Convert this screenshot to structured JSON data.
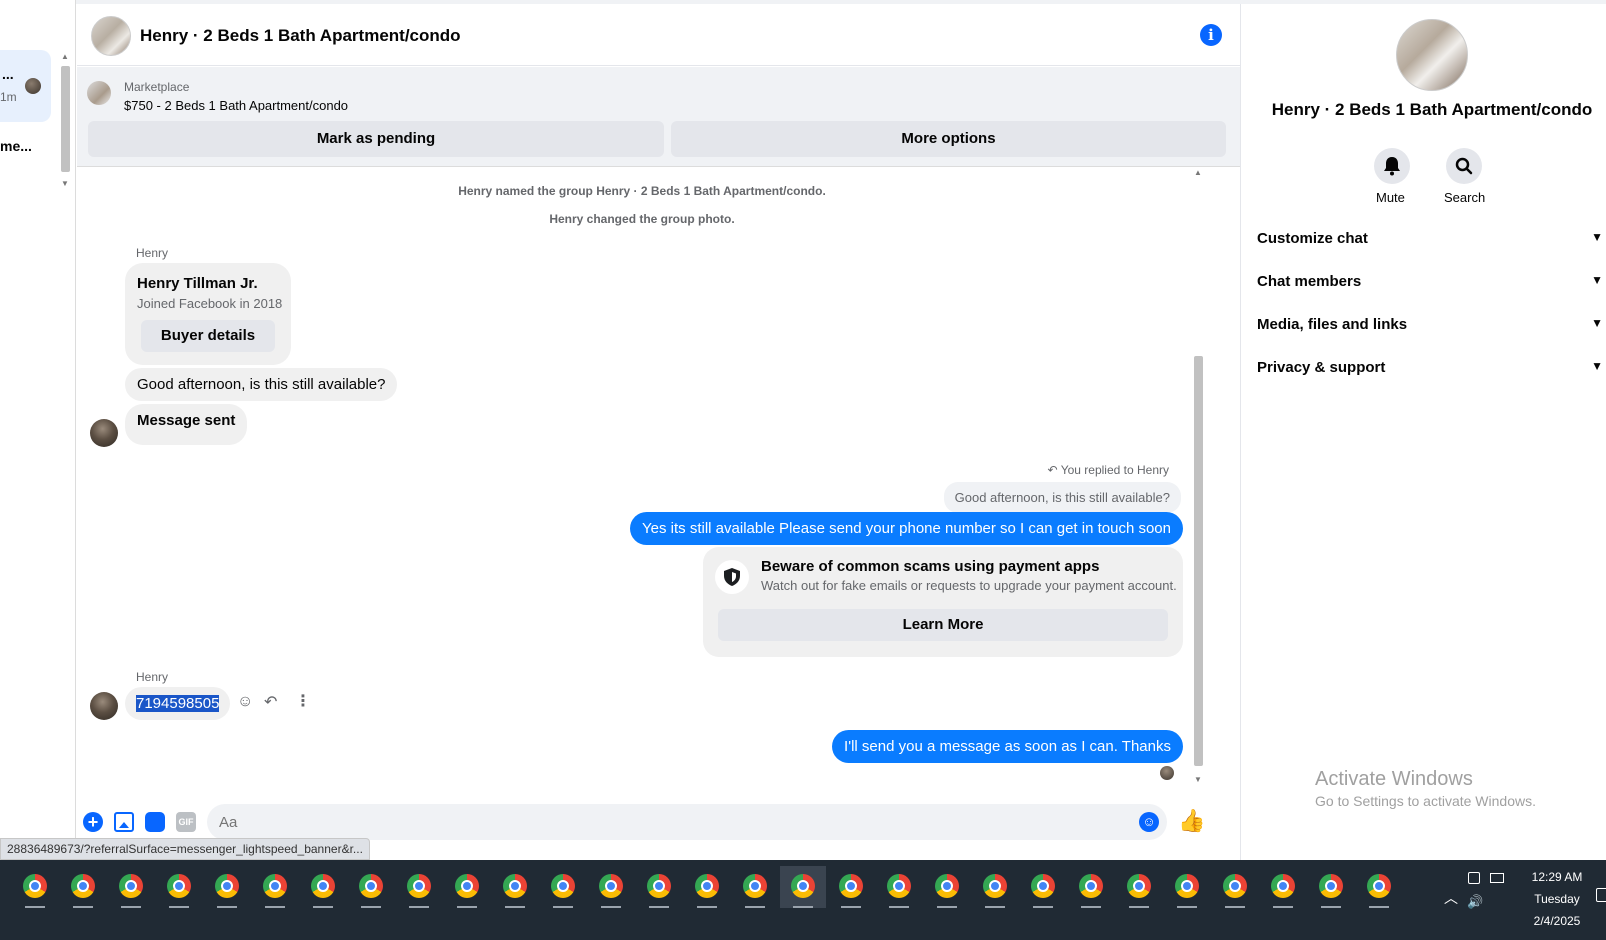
{
  "left_list": {
    "active_title": "...",
    "active_time": "1m",
    "second_title": "me..."
  },
  "header": {
    "title": "Henry · 2 Beds 1 Bath Apartment/condo",
    "info_icon": "i"
  },
  "marketplace": {
    "label": "Marketplace",
    "listing": "$750 - 2 Beds 1 Bath Apartment/condo",
    "pending_label": "Mark as pending",
    "more_label": "More options"
  },
  "messages": {
    "system": [
      "Henry named the group Henry · 2 Beds 1 Bath Apartment/condo.",
      "Henry changed the group photo."
    ],
    "sender_1": "Henry",
    "profile_card": {
      "name": "Henry Tillman Jr.",
      "joined": "Joined Facebook in 2018",
      "button": "Buyer details"
    },
    "incoming_1": "Good afternoon, is this still available?",
    "incoming_2": "Message sent",
    "reply_label": "You replied to Henry",
    "reply_quote": "Good afternoon, is this still available?",
    "outgoing_1": "Yes its still available Please send your phone number so I can get in touch soon",
    "scam_card": {
      "title": "Beware of common scams using payment apps",
      "body": "Watch out for fake emails or requests to upgrade your payment account.",
      "button": "Learn More"
    },
    "sender_2": "Henry",
    "incoming_3": "7194598505",
    "outgoing_2": "I'll send you a message as soon as I can. Thanks"
  },
  "composer": {
    "placeholder": "Aa",
    "gif_label": "GIF"
  },
  "url_status": "28836489673/?referralSurface=messenger_lightspeed_banner&r...",
  "info_panel": {
    "title": "Henry · 2 Beds 1 Bath Apartment/condo",
    "mute_label": "Mute",
    "search_label": "Search",
    "rows": [
      "Customize chat",
      "Chat members",
      "Media, files and links",
      "Privacy & support"
    ]
  },
  "watermark": {
    "line1": "Activate Windows",
    "line2": "Go to Settings to activate Windows."
  },
  "taskbar": {
    "time": "12:29 AM",
    "day": "Tuesday",
    "date": "2/4/2025"
  },
  "colors": {
    "accent": "#0866ff",
    "outgoing_bubble": "#0a7cff",
    "taskbar": "#202a34"
  }
}
